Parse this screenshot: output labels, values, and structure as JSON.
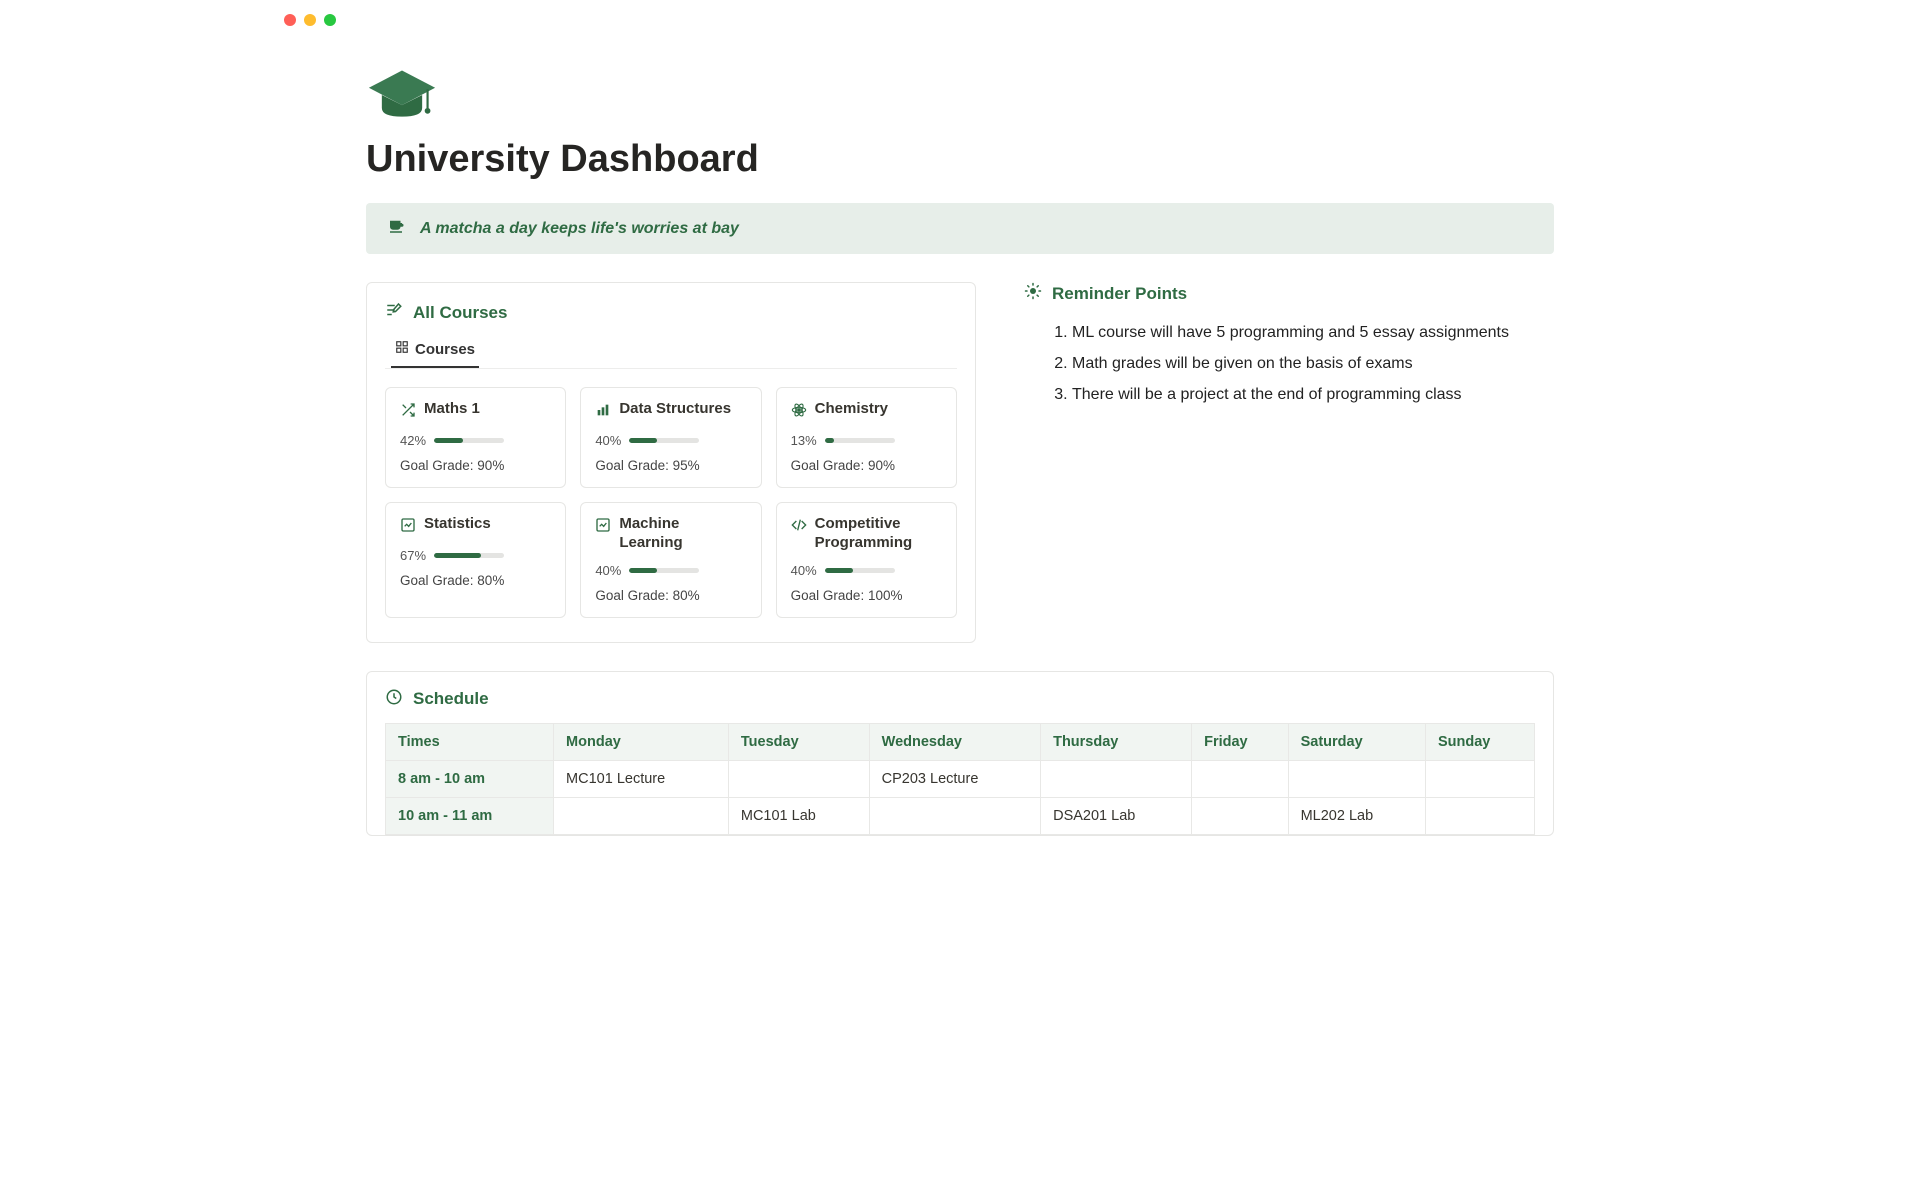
{
  "page": {
    "title": "University Dashboard"
  },
  "quote": {
    "text": "A matcha a day keeps life's worries at bay"
  },
  "courses_panel": {
    "title": "All Courses",
    "tab_label": "Courses",
    "goal_prefix": "Goal Grade: ",
    "cards": [
      {
        "icon": "shuffle",
        "name": "Maths 1",
        "pct": "42%",
        "pct_n": 42,
        "goal": "90%"
      },
      {
        "icon": "bars",
        "name": "Data Structures",
        "pct": "40%",
        "pct_n": 40,
        "goal": "95%"
      },
      {
        "icon": "atom",
        "name": "Chemistry",
        "pct": "13%",
        "pct_n": 13,
        "goal": "90%"
      },
      {
        "icon": "chart",
        "name": "Statistics",
        "pct": "67%",
        "pct_n": 67,
        "goal": "80%"
      },
      {
        "icon": "chart",
        "name": "Machine Learning",
        "pct": "40%",
        "pct_n": 40,
        "goal": "80%"
      },
      {
        "icon": "code",
        "name": "Competitive Programming",
        "pct": "40%",
        "pct_n": 40,
        "goal": "100%"
      }
    ]
  },
  "reminders": {
    "title": "Reminder Points",
    "items": [
      "ML course will have 5 programming and 5 essay assignments",
      "Math grades will be given on the basis of exams",
      "There will be a project at the end of programming class"
    ]
  },
  "schedule": {
    "title": "Schedule",
    "columns": [
      "Times",
      "Monday",
      "Tuesday",
      "Wednesday",
      "Thursday",
      "Friday",
      "Saturday",
      "Sunday"
    ],
    "rows": [
      {
        "time": "8 am - 10 am",
        "cells": [
          "MC101 Lecture",
          "",
          "CP203 Lecture",
          "",
          "",
          "",
          ""
        ]
      },
      {
        "time": "10 am - 11 am",
        "cells": [
          "",
          "MC101 Lab",
          "",
          "DSA201 Lab",
          "",
          "ML202 Lab",
          ""
        ]
      }
    ]
  }
}
